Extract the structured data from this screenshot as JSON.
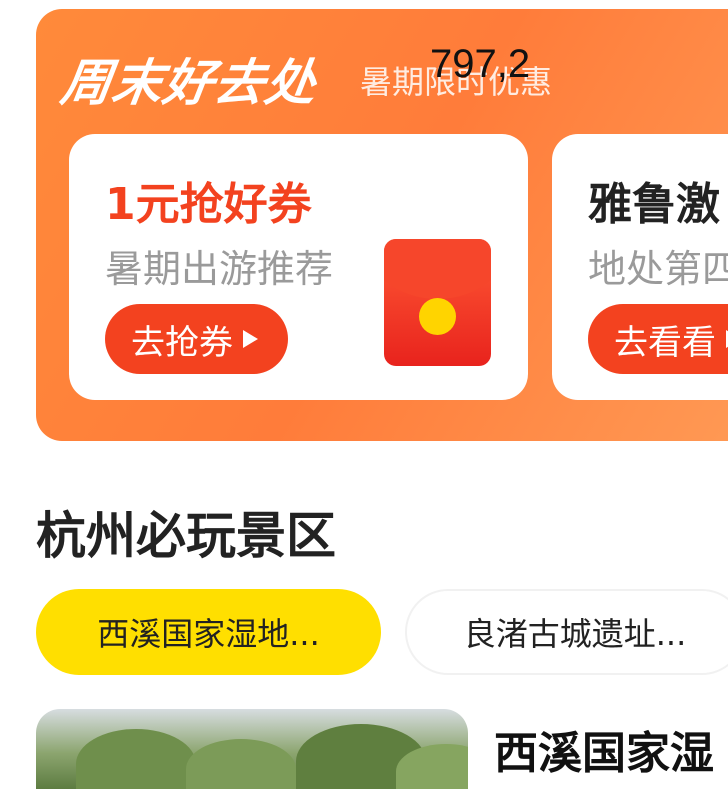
{
  "banner": {
    "title": "周末好去处",
    "subtitle": "暑期限时优惠",
    "overlay_number": "797,2"
  },
  "promo_cards": [
    {
      "title": "1元抢好券",
      "description": "暑期出游推荐",
      "button_label": "去抢券"
    },
    {
      "title": "雅鲁激",
      "description": "地处第四",
      "button_label": "去看看"
    }
  ],
  "section": {
    "title": "杭州必玩景区"
  },
  "chips": [
    {
      "label": "西溪国家湿地...",
      "selected": true
    },
    {
      "label": "良渚古城遗址...",
      "selected": false
    }
  ],
  "featured_spot": {
    "title": "西溪国家湿"
  },
  "colors": {
    "banner_orange": "#ff8a3a",
    "accent_red": "#f3421f",
    "chip_selected": "#ffdf00"
  }
}
